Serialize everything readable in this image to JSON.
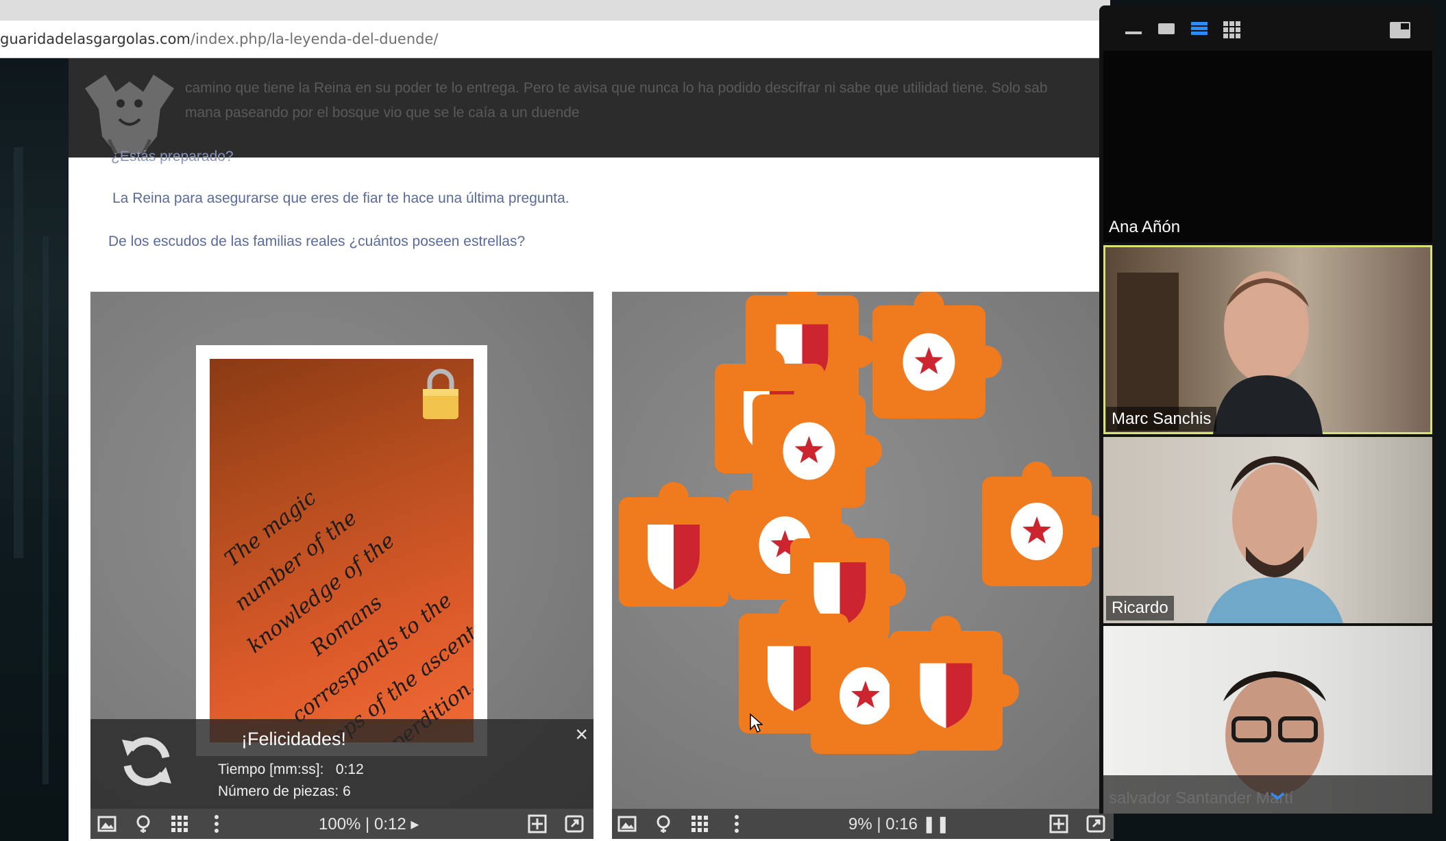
{
  "browser": {
    "url_domain": "guaridadelasgargolas.com",
    "url_path": "/index.php/la-leyenda-del-duende/"
  },
  "header": {
    "line1": "camino que tiene la Reina en su poder te lo entrega. Pero te avisa que nunca lo ha podido descifrar ni sabe que utilidad tiene. Solo sab",
    "line2": "mana paseando por el bosque vio que se le caía a un duende"
  },
  "content": {
    "partial_line": "¿Estás preparado?",
    "p1": "La Reina para asegurarse que eres de fiar te hace una última pregunta.",
    "p2": "De los escudos de las familias reales ¿cuántos poseen estrellas?"
  },
  "card": {
    "lines": [
      "The magic",
      "number of the",
      "knowledge of the",
      "Romans",
      "corresponds to the",
      "steps of the ascent",
      "to perdition."
    ]
  },
  "congrats": {
    "title": "¡Felicidades!",
    "time_label": "Tiempo [mm:ss]:",
    "time_value": "0:12",
    "pieces_label": "Número de piezas:",
    "pieces_value": "6",
    "close": "×"
  },
  "left_toolbar": {
    "status": "100% | 0:12 ▸"
  },
  "right_toolbar": {
    "status": "9% | 0:16 ❚❚"
  },
  "zoom": {
    "participants": [
      {
        "name": "Ana Añón"
      },
      {
        "name": "Marc Sanchis"
      },
      {
        "name": "Ricardo"
      },
      {
        "name": "salvador Santander Martí"
      }
    ]
  }
}
